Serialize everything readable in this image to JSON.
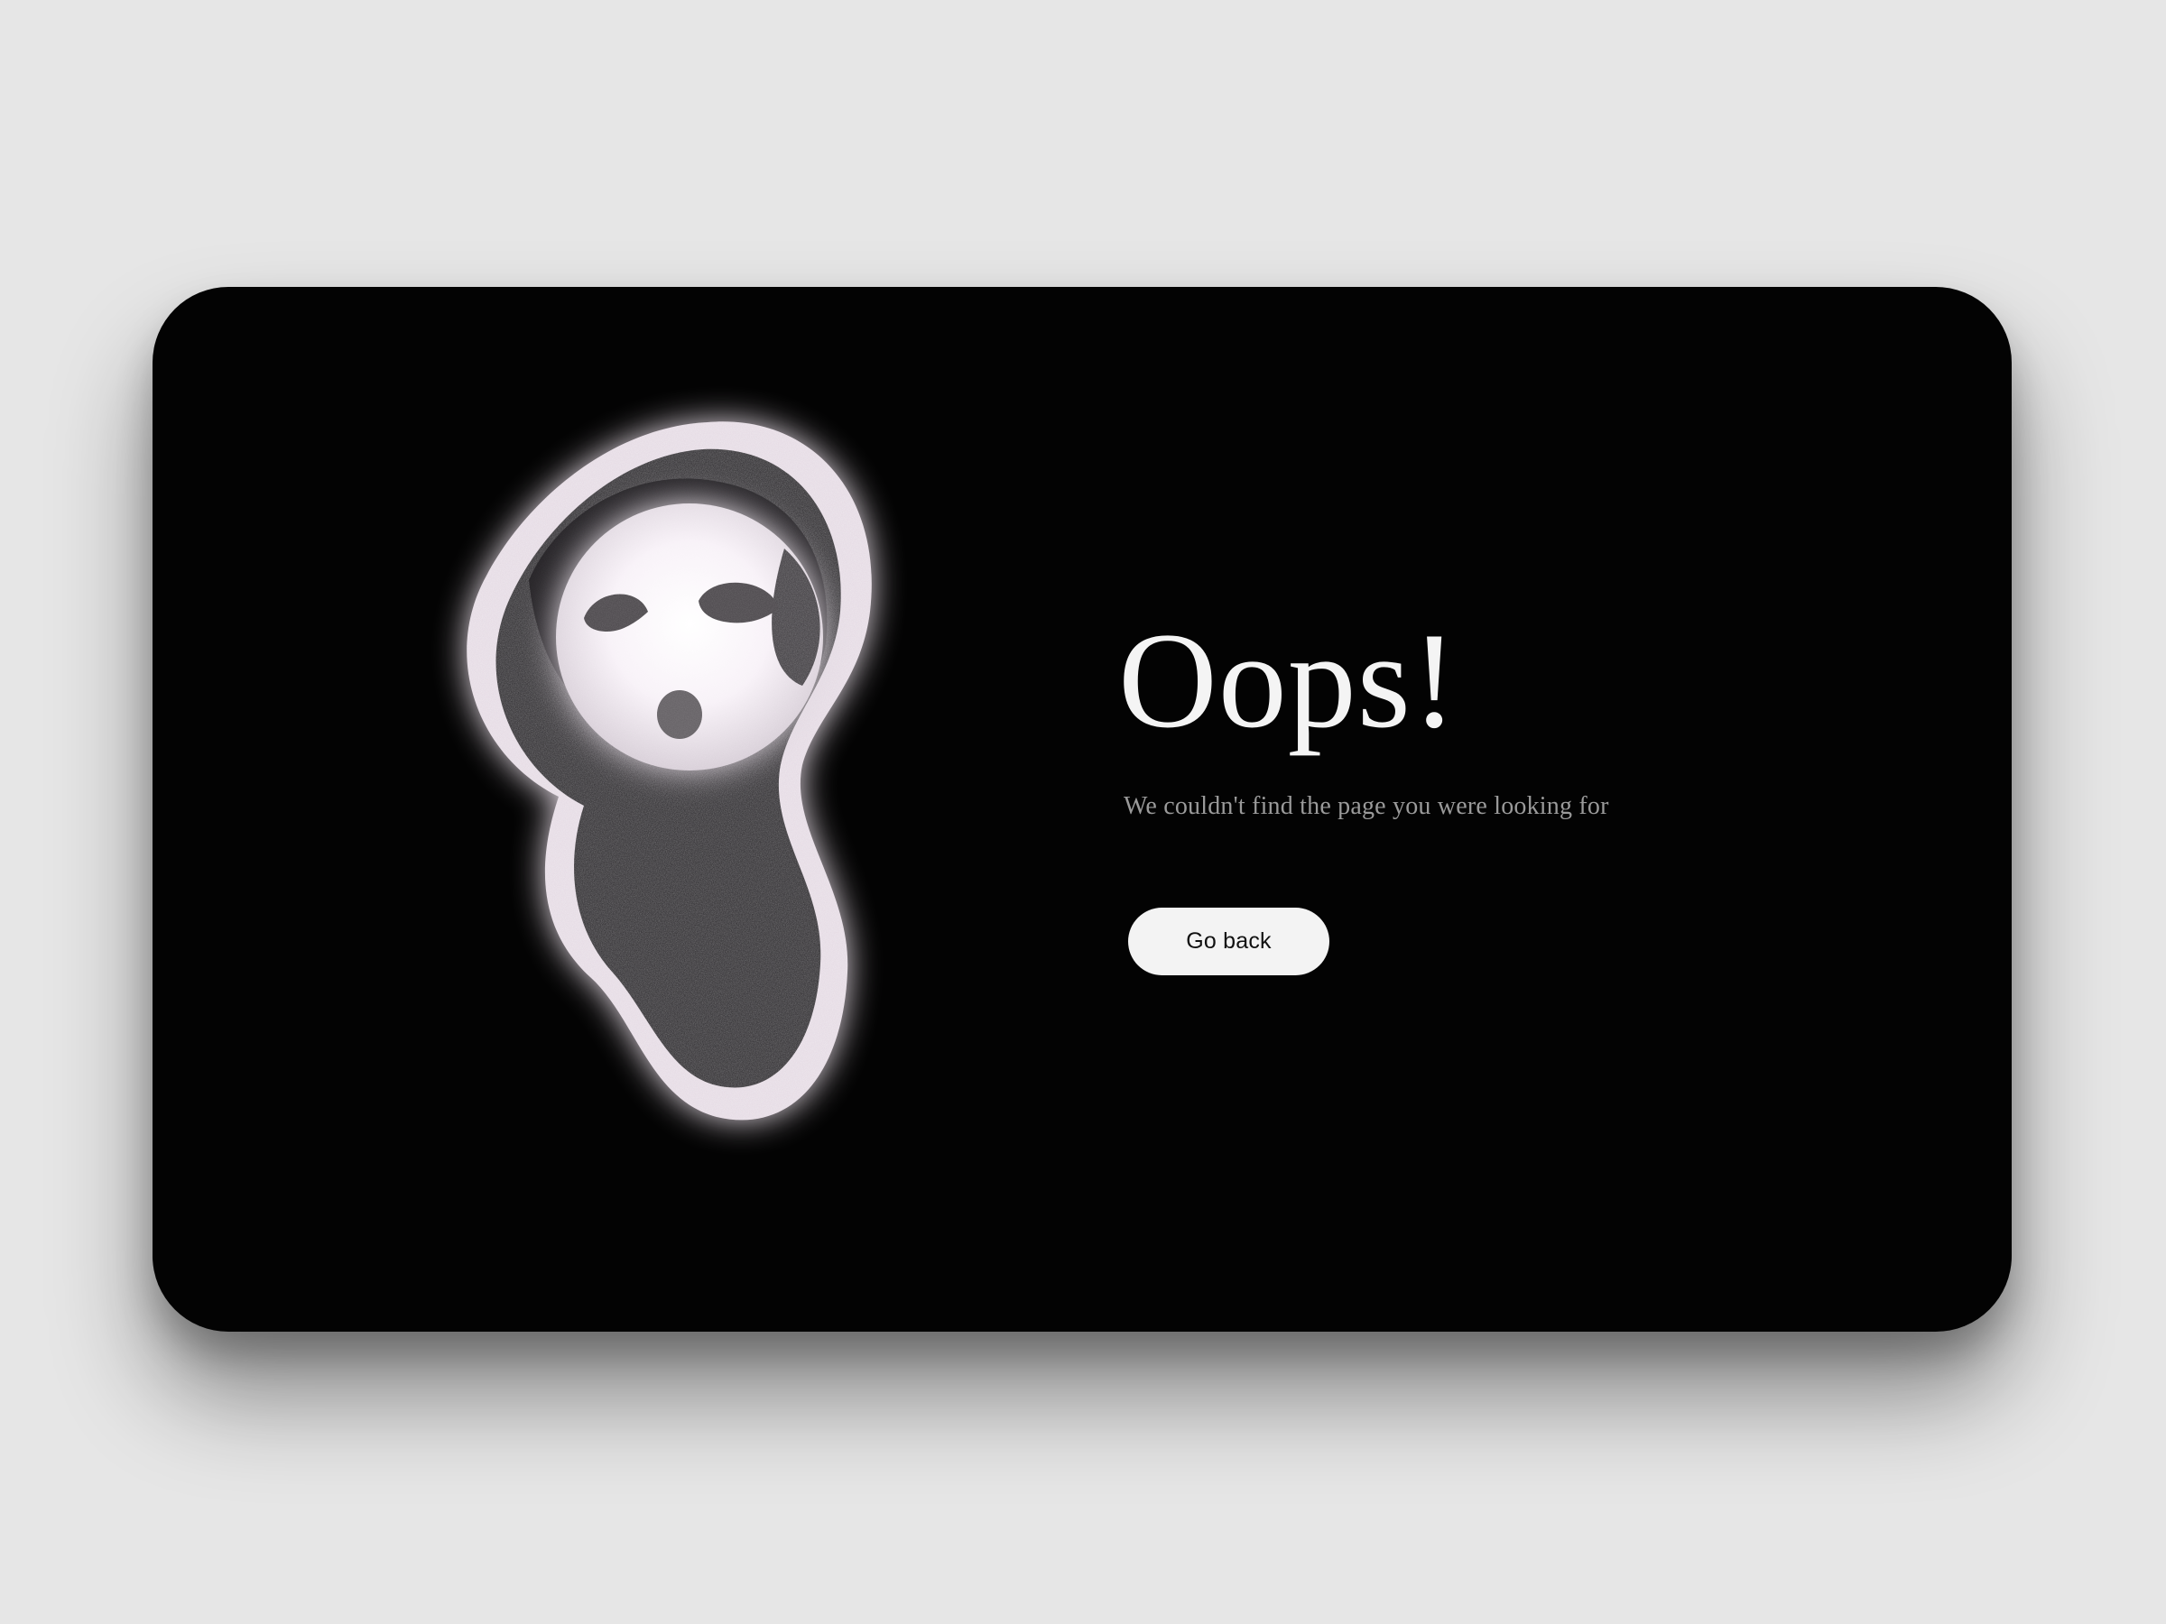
{
  "page": {
    "background_color": "#e6e6e6",
    "card_color": "#030303",
    "accent_color": "#f4eef4"
  },
  "illustration": {
    "icon_name": "sad-ghost-illustration",
    "icon_label": "ghost"
  },
  "message": {
    "title": "Oops!",
    "subtitle": "We couldn't find the page you were looking for"
  },
  "actions": {
    "go_back_label": "Go back"
  }
}
